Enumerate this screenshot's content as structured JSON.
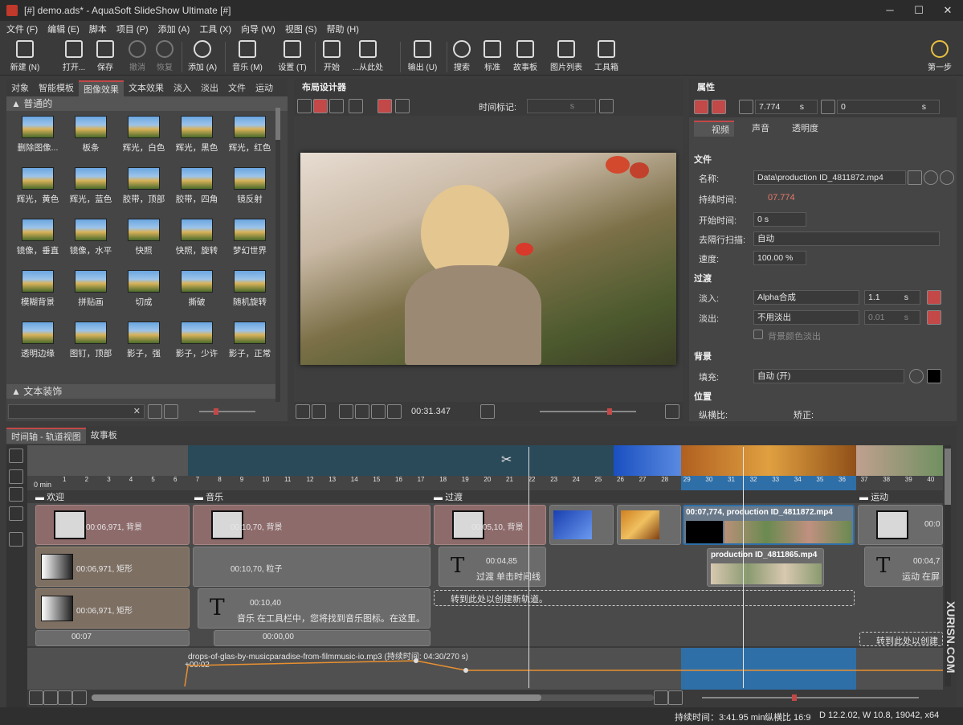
{
  "window": {
    "title": "[#] demo.ads* - AquaSoft SlideShow Ultimate [#]",
    "min": "─",
    "max": "☐",
    "close": "✕"
  },
  "menu": [
    "文件 (F)",
    "编辑 (E)",
    "脚本",
    "项目 (P)",
    "添加 (A)",
    "工具 (X)",
    "向导 (W)",
    "视图 (S)",
    "帮助 (H)"
  ],
  "toolbar": {
    "new": "新建 (N)",
    "open": "打开...",
    "save": "保存",
    "undo": "撤消",
    "redo": "恢复",
    "add": "添加 (A)",
    "music": "音乐 (M)",
    "settings": "设置 (T)",
    "start": "开始",
    "from_here": "...从此处",
    "output": "输出 (U)",
    "search": "搜索",
    "standard": "标准",
    "storyboard": "故事板",
    "image_list": "图片列表",
    "toolbox": "工具箱",
    "first_step": "第一步"
  },
  "left_panel": {
    "tabs": [
      "对象",
      "智能模板",
      "图像效果",
      "文本效果",
      "淡入",
      "淡出",
      "文件",
      "运动"
    ],
    "active_tab": "图像效果",
    "group1": "普通的",
    "effects": [
      "删除图像...",
      "板条",
      "辉光，白色",
      "辉光，黑色",
      "辉光，红色",
      "辉光，黄色",
      "辉光，蓝色",
      "胶带，顶部",
      "胶带，四角",
      "镜反射",
      "镜像，垂直",
      "镜像，水平",
      "快照",
      "快照，旋转",
      "梦幻世界",
      "模糊背景",
      "拼贴画",
      "切成",
      "撕破",
      "随机旋转",
      "透明边缘",
      "图钉，顶部",
      "影子，强",
      "影子，少许",
      "影子，正常"
    ],
    "group2": "文本装饰"
  },
  "designer": {
    "title": "布局设计器",
    "time_marker_label": "时间标记:",
    "time_marker_unit": "s",
    "playtime": "00:31.347"
  },
  "properties": {
    "title": "属性",
    "duration_value": "7.774",
    "duration_unit": "s",
    "offset_value": "0",
    "offset_unit": "s",
    "tabs": [
      "视频",
      "声音",
      "透明度"
    ],
    "section_file": "文件",
    "name_label": "名称:",
    "name_value": "Data\\production ID_4811872.mp4",
    "duration_label": "持续时间:",
    "duration_text": "07.774",
    "start_label": "开始时间:",
    "start_value": "0 s",
    "deinterlace_label": "去隔行扫描:",
    "deinterlace_value": "自动",
    "speed_label": "速度:",
    "speed_value": "100.00 %",
    "section_transition": "过渡",
    "fadein_label": "淡入:",
    "fadein_value": "Alpha合成",
    "fadein_time": "1.1",
    "fadein_unit": "s",
    "fadeout_label": "淡出:",
    "fadeout_value": "不用淡出",
    "fadeout_time": "0.01",
    "fadeout_unit": "s",
    "bgfade_label": "背景颜色淡出",
    "section_background": "背景",
    "fill_label": "填充:",
    "fill_value": "自动 (开)",
    "section_position": "位置",
    "aspect_label": "纵横比:",
    "correct_label": "矫正:"
  },
  "timeline": {
    "tabs": [
      "时间轴 - 轨道视图",
      "故事板"
    ],
    "ruler_start": "0 min",
    "ruler_numbers": [
      "1",
      "2",
      "3",
      "4",
      "5",
      "6",
      "7",
      "8",
      "9",
      "10",
      "11",
      "12",
      "13",
      "14",
      "15",
      "16",
      "17",
      "18",
      "19",
      "20",
      "21",
      "22",
      "23",
      "24",
      "25",
      "26",
      "27",
      "28",
      "29",
      "30",
      "31",
      "32",
      "33",
      "34",
      "35",
      "36",
      "37",
      "38",
      "39",
      "40"
    ],
    "chapters": [
      "欢迎",
      "音乐",
      "过渡",
      "运动"
    ],
    "clips": {
      "welcome_bg": "00:06,971, 背景",
      "welcome_rect1": "00:06,971, 矩形",
      "welcome_rect2": "00:06,971, 矩形",
      "music_bg": "00:10,70, 背景",
      "music_particle": "00:10,70, 粒子",
      "music_text_time": "00:10,40",
      "music_text": "音乐 在工具栏中，您将找到音乐图标。在这里。",
      "trans_bg": "00:05,10, 背景",
      "trans_text_time": "00:04,85",
      "trans_text": "过渡 单击时间线",
      "video1": "00:07,774, production ID_4811872.mp4",
      "video2": "production ID_4811865.mp4",
      "new_track_hint": "转到此处以创建新轨道。",
      "motion_bg": "00:0",
      "motion_text_time": "00:04,7",
      "motion_text": "运动 在屏",
      "motion_new_track": "转到此处以创建",
      "small_time_1": "00:07",
      "small_time_2": "00:00,00"
    },
    "audio": {
      "file": "drops-of-glas-by-musicparadise-from-filmmusic-io.mp3 (持续时间:",
      "duration": "04:30/270 s)",
      "offset": "+00:02"
    }
  },
  "status": {
    "duration": "持续时间：3:41.95 min",
    "aspect": "纵横比 16:9",
    "dims": "D 12.2.02, W 10.8, 19042, x64"
  },
  "watermark": "XURISN.COM",
  "colors": {
    "accent": "#c34848",
    "selection": "#2f6fa8"
  }
}
